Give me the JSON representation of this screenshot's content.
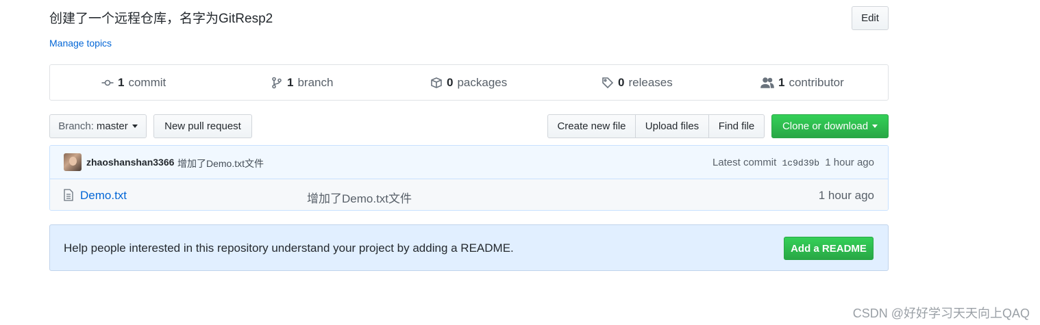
{
  "repo": {
    "description": "创建了一个远程仓库，名字为GitResp2",
    "edit_label": "Edit",
    "manage_topics": "Manage topics"
  },
  "summary": {
    "commits": {
      "count": "1",
      "label": "commit",
      "icon": "commit-icon"
    },
    "branches": {
      "count": "1",
      "label": "branch",
      "icon": "branch-icon"
    },
    "packages": {
      "count": "0",
      "label": "packages",
      "icon": "package-icon"
    },
    "releases": {
      "count": "0",
      "label": "releases",
      "icon": "tag-icon"
    },
    "contributors": {
      "count": "1",
      "label": "contributor",
      "icon": "people-icon"
    }
  },
  "toolbar": {
    "branch_prefix": "Branch:",
    "branch_name": "master",
    "new_pull_request": "New pull request",
    "create_new_file": "Create new file",
    "upload_files": "Upload files",
    "find_file": "Find file",
    "clone_or_download": "Clone or download"
  },
  "latest_commit": {
    "author": "zhaoshanshan3366",
    "message": "增加了Demo.txt文件",
    "label": "Latest commit",
    "sha": "1c9d39b",
    "age": "1 hour ago"
  },
  "files": [
    {
      "name": "Demo.txt",
      "message": "增加了Demo.txt文件",
      "age": "1 hour ago",
      "icon": "file-text-icon"
    }
  ],
  "readme_prompt": {
    "text": "Help people interested in this repository understand your project by adding a README.",
    "button": "Add a README"
  },
  "watermark": "CSDN @好好学习天天向上QAQ",
  "colors": {
    "accent": "#0366d6",
    "primary_button": "#28a745",
    "commit_bar": "#f1f8ff",
    "readme_bg": "#e1efff"
  }
}
